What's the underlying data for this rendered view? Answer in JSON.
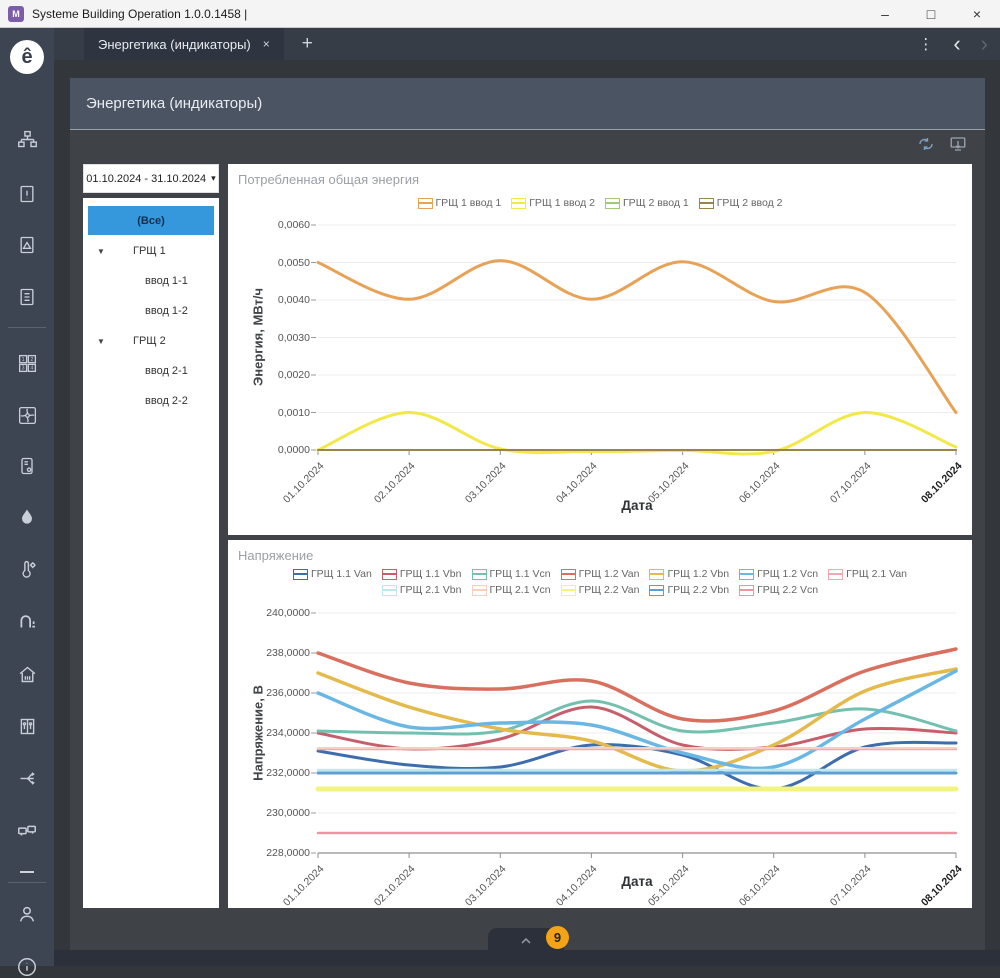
{
  "window": {
    "title": "Systeme Building Operation 1.0.0.1458 |",
    "controls": {
      "minimize": "–",
      "maximize": "□",
      "close": "×"
    }
  },
  "tabbar": {
    "active_tab": "Энергетика (индикаторы)",
    "close_label": "×",
    "add_label": "+",
    "menu_icon": "⋮",
    "back_icon": "‹",
    "forward_icon": "›"
  },
  "sidebar": {
    "icons": [
      "schneider-logo",
      "system-tree",
      "document-warning",
      "document-alarm",
      "document-report",
      "values-grid",
      "fan",
      "controller",
      "water-drop",
      "temperature",
      "pipes",
      "home",
      "elevator",
      "distribution",
      "connector",
      "collapse-dash",
      "user",
      "info"
    ]
  },
  "header": {
    "title": "Энергетика (индикаторы)"
  },
  "toolbar": {
    "icons": [
      "refresh",
      "send-to-screen"
    ]
  },
  "panel": {
    "date_range": "01.10.2024 - 31.10.2024",
    "date_caret": "▾",
    "tree": {
      "caret_glyph": "▼",
      "items": [
        {
          "label": "(Все)",
          "level": 0,
          "selected": true
        },
        {
          "label": "ГРЩ 1",
          "level": 1,
          "expanded": true
        },
        {
          "label": "ввод 1-1",
          "level": 2
        },
        {
          "label": "ввод 1-2",
          "level": 2
        },
        {
          "label": "ГРЩ 2",
          "level": 1,
          "expanded": true
        },
        {
          "label": "ввод 2-1",
          "level": 2
        },
        {
          "label": "ввод 2-2",
          "level": 2
        }
      ]
    }
  },
  "chart_data": [
    {
      "type": "line",
      "title": "Потребленная общая энергия",
      "xlabel": "Дата",
      "ylabel": "Энергия, МВт/ч",
      "x": [
        "01.10.2024",
        "02.10.2024",
        "03.10.2024",
        "04.10.2024",
        "05.10.2024",
        "06.10.2024",
        "07.10.2024",
        "08.10.2024"
      ],
      "ylim": [
        0,
        0.006
      ],
      "yticks": [
        "0,0060",
        "0,0050",
        "0,0040",
        "0,0030",
        "0,0020",
        "0,0010",
        "0,0000"
      ],
      "grid": true,
      "legend_position": "top",
      "series": [
        {
          "name": "ГРЩ 1 ввод 1",
          "color": "#e8a256",
          "width": 3,
          "values": [
            0.005,
            0.00402,
            0.00505,
            0.00402,
            0.00502,
            0.00396,
            0.0042,
            0.001
          ]
        },
        {
          "name": "ГРЩ 1 ввод 2",
          "color": "#f2e847",
          "width": 3,
          "values": [
            0.0,
            0.001,
            3e-05,
            -4e-05,
            -1e-05,
            -4e-05,
            0.001,
            8e-05
          ]
        },
        {
          "name": "ГРЩ 2 ввод 1",
          "color": "#9fca7a",
          "width": 2,
          "values": [
            0,
            0,
            0,
            0,
            0,
            0,
            0,
            0
          ]
        },
        {
          "name": "ГРЩ 2 ввод 2",
          "color": "#9a8449",
          "width": 2,
          "values": [
            0,
            0,
            0,
            0,
            0,
            0,
            0,
            0
          ]
        }
      ]
    },
    {
      "type": "line",
      "title": "Напряжение",
      "xlabel": "Дата",
      "ylabel": "Напряжение, В",
      "x": [
        "01.10.2024",
        "02.10.2024",
        "03.10.2024",
        "04.10.2024",
        "05.10.2024",
        "06.10.2024",
        "07.10.2024",
        "08.10.2024"
      ],
      "ylim": [
        228,
        240
      ],
      "yticks": [
        "240,0000",
        "238,0000",
        "236,0000",
        "234,0000",
        "232,0000",
        "230,0000",
        "228,0000"
      ],
      "grid": true,
      "legend_position": "top",
      "series": [
        {
          "name": "ГРЩ 1.1 Van",
          "color": "#3d6dac",
          "width": 3,
          "values": [
            233.1,
            232.4,
            232.3,
            233.4,
            232.9,
            231.2,
            233.3,
            233.5
          ]
        },
        {
          "name": "ГРЩ 1.1 Vbn",
          "color": "#c65f6b",
          "width": 3,
          "values": [
            234.0,
            233.2,
            233.7,
            235.3,
            233.4,
            233.3,
            234.2,
            234.0
          ]
        },
        {
          "name": "ГРЩ 1.1 Vcn",
          "color": "#74c0ae",
          "width": 3,
          "values": [
            234.1,
            234.0,
            234.1,
            235.6,
            234.1,
            234.5,
            235.2,
            234.1
          ]
        },
        {
          "name": "ГРЩ 1.2 Van",
          "color": "#d9705f",
          "width": 3.5,
          "values": [
            238.0,
            236.5,
            236.2,
            236.6,
            234.7,
            235.1,
            237.1,
            238.2
          ]
        },
        {
          "name": "ГРЩ 1.2 Vbn",
          "color": "#e5ba4c",
          "width": 3.5,
          "values": [
            237.0,
            235.3,
            234.2,
            233.6,
            232.1,
            233.4,
            236.1,
            237.2
          ]
        },
        {
          "name": "ГРЩ 1.2 Vcn",
          "color": "#69b7e4",
          "width": 3.5,
          "values": [
            236.0,
            234.3,
            234.5,
            234.4,
            233.0,
            232.3,
            234.7,
            237.1
          ]
        },
        {
          "name": "ГРЩ 2.1 Van",
          "color": "#f2a7b1",
          "width": 2.5,
          "values": [
            233.2,
            233.2,
            233.2,
            233.2,
            233.2,
            233.2,
            233.2,
            233.2
          ]
        },
        {
          "name": "ГРЩ 2.1 Vbn",
          "color": "#bfe7ee",
          "width": 2.5,
          "values": [
            232.15,
            232.15,
            232.15,
            232.15,
            232.15,
            232.15,
            232.15,
            232.15
          ]
        },
        {
          "name": "ГРЩ 2.1 Vcn",
          "color": "#f6cfc0",
          "width": 2,
          "values": [
            233.25,
            233.25,
            233.25,
            233.25,
            233.25,
            233.25,
            233.25,
            233.25
          ]
        },
        {
          "name": "ГРЩ 2.2 Van",
          "color": "#f3f47e",
          "width": 5,
          "values": [
            231.2,
            231.2,
            231.2,
            231.2,
            231.2,
            231.2,
            231.2,
            231.2
          ]
        },
        {
          "name": "ГРЩ 2.2 Vbn",
          "color": "#5d9fd3",
          "width": 3,
          "values": [
            232.0,
            232.0,
            232.0,
            232.0,
            232.0,
            232.0,
            232.0,
            232.0
          ]
        },
        {
          "name": "ГРЩ 2.2 Vcn",
          "color": "#f194a1",
          "width": 2.5,
          "values": [
            229.0,
            229.0,
            229.0,
            229.0,
            229.0,
            229.0,
            229.0,
            229.0
          ]
        }
      ]
    }
  ],
  "footer": {
    "badge_count": "9",
    "collapse_icon": "chevron-up"
  }
}
